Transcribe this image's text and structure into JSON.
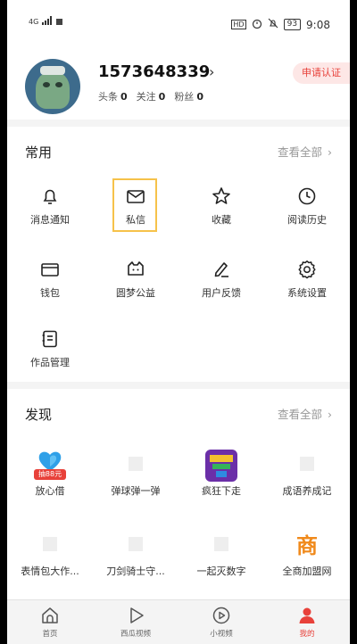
{
  "status_bar": {
    "network": "4G",
    "hd": "HD",
    "battery": "93",
    "time": "9:08"
  },
  "profile": {
    "user_id": "1573648339",
    "stats": [
      {
        "label": "头条",
        "value": "0"
      },
      {
        "label": "关注",
        "value": "0"
      },
      {
        "label": "粉丝",
        "value": "0"
      }
    ],
    "apply_label": "申请认证"
  },
  "common": {
    "title": "常用",
    "more": "查看全部",
    "items": [
      {
        "label": "消息通知",
        "icon": "bell-icon"
      },
      {
        "label": "私信",
        "icon": "mail-icon"
      },
      {
        "label": "收藏",
        "icon": "star-icon"
      },
      {
        "label": "阅读历史",
        "icon": "clock-icon"
      },
      {
        "label": "钱包",
        "icon": "wallet-icon"
      },
      {
        "label": "圆梦公益",
        "icon": "charity-icon"
      },
      {
        "label": "用户反馈",
        "icon": "pen-icon"
      },
      {
        "label": "系统设置",
        "icon": "gear-icon"
      },
      {
        "label": "作品管理",
        "icon": "works-icon"
      }
    ]
  },
  "discover": {
    "title": "发现",
    "more": "查看全部",
    "items": [
      {
        "label": "放心借",
        "icon": "loan-app-icon",
        "badge": "抽88元"
      },
      {
        "label": "弹球弹一弹",
        "icon": "placeholder-icon"
      },
      {
        "label": "疯狂下走",
        "icon": "game-app-icon"
      },
      {
        "label": "成语养成记",
        "icon": "placeholder-icon"
      },
      {
        "label": "表情包大作...",
        "icon": "placeholder-icon"
      },
      {
        "label": "刀剑骑士守...",
        "icon": "placeholder-icon"
      },
      {
        "label": "一起灭数字",
        "icon": "placeholder-icon"
      },
      {
        "label": "全商加盟网",
        "icon": "shop-app-icon",
        "icon_text": "商"
      }
    ]
  },
  "tabbar": {
    "items": [
      {
        "label": "首页",
        "icon": "home-icon",
        "active": false
      },
      {
        "label": "西瓜视频",
        "icon": "play-icon",
        "active": false
      },
      {
        "label": "小视频",
        "icon": "short-video-icon",
        "active": false
      },
      {
        "label": "我的",
        "icon": "person-icon",
        "active": true
      }
    ]
  },
  "colors": {
    "accent": "#e8413a",
    "highlight_border": "#f6c24a"
  }
}
